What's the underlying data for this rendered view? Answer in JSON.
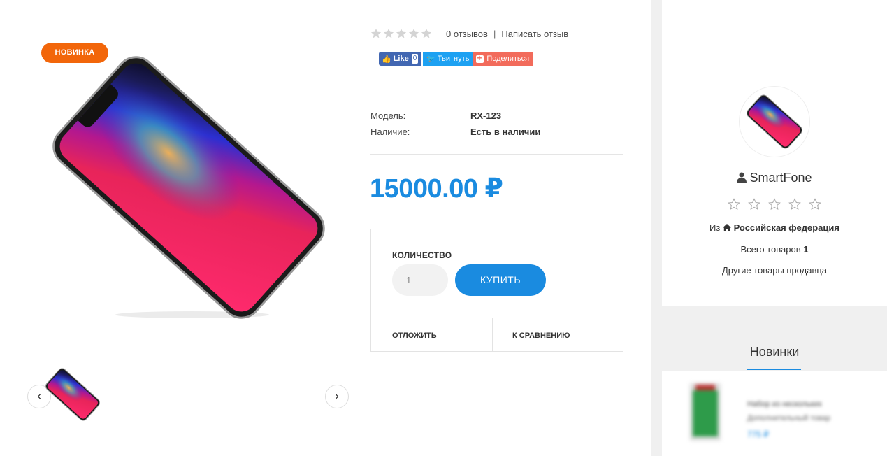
{
  "product": {
    "badge": "НОВИНКА",
    "rating": 0,
    "reviews_label": "0 отзывов",
    "separator": "|",
    "write_review_label": "Написать отзыв",
    "social": {
      "fb_like": "Like",
      "fb_count": "0",
      "tweet": "Твитнуть",
      "share": "Поделиться"
    },
    "specs": [
      {
        "label": "Модель:",
        "value": "RX-123"
      },
      {
        "label": "Наличие:",
        "value": "Есть в наличии"
      }
    ],
    "price": "15000.00 ₽",
    "quantity_label": "КОЛИЧЕСТВО",
    "quantity_value": "1",
    "buy_label": "КУПИТЬ",
    "wishlist_label": "ОТЛОЖИТЬ",
    "compare_label": "К СРАВНЕНИЮ"
  },
  "seller": {
    "name": "SmartFone",
    "rating": 0,
    "from_prefix": "Из",
    "country": "Российская федерация",
    "total_prefix": "Всего товаров",
    "total_count": "1",
    "other_products_label": "Другие товары продавца"
  },
  "new_products": {
    "title": "Новинки",
    "items": [
      {
        "title": "Набор из нескольких",
        "subtitle": "Дополнительный товар",
        "price": "775 ₽"
      }
    ]
  },
  "colors": {
    "accent": "#1a8be0",
    "badge": "#f2660a",
    "facebook": "#4267b2",
    "twitter": "#1da1f2",
    "share": "#f26b5b"
  },
  "icons": [
    "star-icon",
    "facebook-like-icon",
    "twitter-icon",
    "share-plus-icon",
    "chevron-left-icon",
    "chevron-right-icon",
    "user-icon",
    "home-icon"
  ]
}
